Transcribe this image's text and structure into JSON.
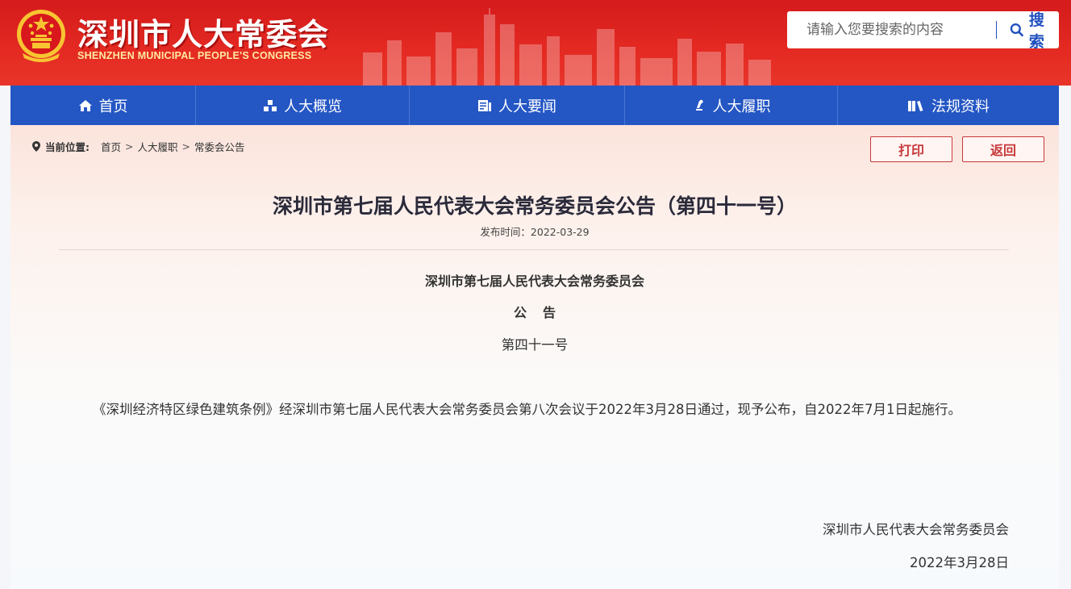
{
  "header": {
    "title": "深圳市人大常委会",
    "subtitle": "SHENZHEN MUNICIPAL PEOPLE'S CONGRESS",
    "search_placeholder": "请输入您要搜索的内容",
    "search_button": "搜索",
    "colors": {
      "primary_red": "#d51b1b",
      "nav_blue": "#2456c4",
      "accent_gold": "#ffd54a"
    }
  },
  "nav": {
    "items": [
      {
        "label": "首页",
        "icon": "home-icon"
      },
      {
        "label": "人大概览",
        "icon": "overview-icon"
      },
      {
        "label": "人大要闻",
        "icon": "news-icon"
      },
      {
        "label": "人大履职",
        "icon": "duty-icon"
      },
      {
        "label": "法规资料",
        "icon": "books-icon"
      }
    ]
  },
  "breadcrumb": {
    "label": "当前位置:",
    "items": [
      "首页",
      "人大履职",
      "常委会公告"
    ],
    "separator": ">"
  },
  "actions": {
    "print": "打印",
    "back": "返回"
  },
  "article": {
    "title": "深圳市第七届人民代表大会常务委员会公告（第四十一号）",
    "publish_label": "发布时间：",
    "publish_date": "2022-03-29",
    "issuer": "深圳市第七届人民代表大会常务委员会",
    "notice_word": "公告",
    "notice_no": "第四十一号",
    "body": "《深圳经济特区绿色建筑条例》经深圳市第七届人民代表大会常务委员会第八次会议于2022年3月28日通过，现予公布，自2022年7月1日起施行。",
    "sign_org": "深圳市人民代表大会常务委员会",
    "sign_date": "2022年3月28日"
  }
}
